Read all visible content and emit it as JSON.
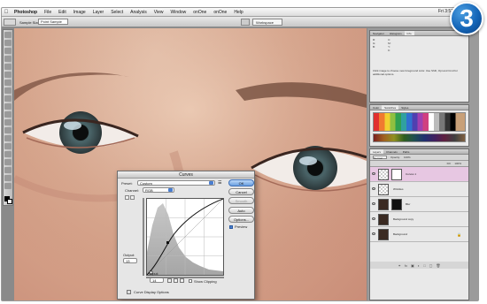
{
  "step_badge": "3",
  "menubar": {
    "apple": "",
    "items": [
      "Photoshop",
      "File",
      "Edit",
      "Image",
      "Layer",
      "Select",
      "Analysis",
      "View",
      "Window",
      "onOne",
      "onOne",
      "Help"
    ],
    "clock": "Fri 3:52"
  },
  "options_bar": {
    "label": "Sample Size:",
    "sample_size": "Point Sample",
    "workspace": "Workspace"
  },
  "panels": {
    "navigator_tabs": [
      "Navigator",
      "Histogram",
      "Info"
    ],
    "info_help": "Click image to choose new foreground color. Use Shift, Opt and Cmd for additional options.",
    "info_rows": [
      "R:",
      "G:",
      "B:",
      "C:",
      "M:",
      "Y:",
      "K:"
    ],
    "swatches_tabs": [
      "Color",
      "Swatches",
      "Styles"
    ],
    "layers_tabs": [
      "Layers",
      "Channels",
      "Paths"
    ],
    "blend_mode": "Normal",
    "opacity_label": "Opacity:",
    "opacity": "100%",
    "fill_label": "Fill:",
    "fill": "100%",
    "layers": [
      {
        "name": "Curves 1",
        "selected": true
      },
      {
        "name": "Wrinkles",
        "selected": false
      },
      {
        "name": "Blur",
        "selected": false
      },
      {
        "name": "Background copy",
        "selected": false
      },
      {
        "name": "Background",
        "selected": false
      }
    ]
  },
  "curves_dialog": {
    "title": "Curves",
    "preset_label": "Preset:",
    "preset_value": "Custom",
    "channel_label": "Channel:",
    "channel_value": "RGB",
    "output_label": "Output:",
    "output_value": "13",
    "input_label": "Input:",
    "input_value": "14",
    "show_clipping": "Show Clipping",
    "display_options": "Curve Display Options",
    "buttons": {
      "ok": "OK",
      "cancel": "Cancel",
      "smooth": "Smooth",
      "auto": "Auto",
      "options": "Options..."
    },
    "preview_label": "Preview",
    "preview_checked": true
  }
}
